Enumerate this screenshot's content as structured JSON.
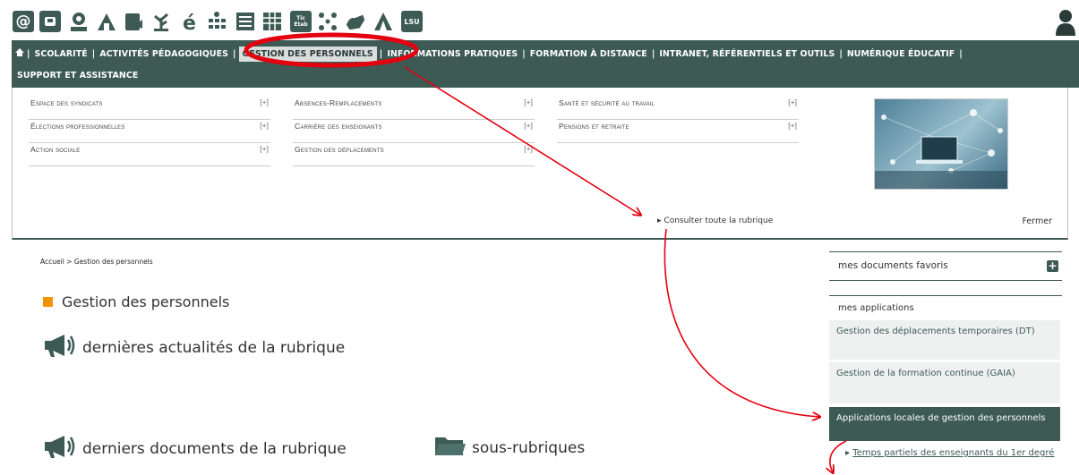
{
  "icon_bar": {
    "icons": [
      {
        "name": "at-icon",
        "glyph": "@"
      },
      {
        "name": "badge-icon",
        "glyph": ""
      },
      {
        "name": "person-icon",
        "glyph": ""
      },
      {
        "name": "reading-icon",
        "glyph": ""
      },
      {
        "name": "book-icon",
        "glyph": ""
      },
      {
        "name": "plant-icon",
        "glyph": ""
      },
      {
        "name": "e-learning-icon",
        "glyph": ""
      },
      {
        "name": "grid-icon",
        "glyph": ""
      },
      {
        "name": "list-icon",
        "glyph": ""
      },
      {
        "name": "table-icon",
        "glyph": ""
      },
      {
        "name": "tic-etab-icon",
        "glyph": "Tic Etab"
      },
      {
        "name": "network-icon",
        "glyph": ""
      },
      {
        "name": "hand-icon",
        "glyph": ""
      },
      {
        "name": "tent-icon",
        "glyph": ""
      },
      {
        "name": "lsu-icon",
        "glyph": "LSU"
      }
    ],
    "user_icon": "user-icon"
  },
  "nav": {
    "home_icon": "home-icon",
    "items": [
      {
        "label": "SCOLARITÉ"
      },
      {
        "label": "ACTIVITÉS PÉDAGOGIQUES"
      },
      {
        "label": "GESTION DES PERSONNELS",
        "active": true
      },
      {
        "label": "INFORMATIONS PRATIQUES"
      },
      {
        "label": "FORMATION À DISTANCE"
      },
      {
        "label": "INTRANET, RÉFÉRENTIELS ET OUTILS"
      },
      {
        "label": "NUMÉRIQUE ÉDUCATIF"
      },
      {
        "label": "SUPPORT ET ASSISTANCE"
      }
    ],
    "separator": "|"
  },
  "mega_menu": {
    "columns": [
      [
        {
          "label": "Espace des syndicats",
          "toggle": "[+]"
        },
        {
          "label": "Élections professionnelles",
          "toggle": "[+]"
        },
        {
          "label": "Action sociale",
          "toggle": "[+]"
        }
      ],
      [
        {
          "label": "Absences-Remplacements",
          "toggle": "[+]"
        },
        {
          "label": "Carrière des enseignants",
          "toggle": "[+]"
        },
        {
          "label": "Gestion des déplacements",
          "toggle": "[+]"
        }
      ],
      [
        {
          "label": "Santé et sécurité au travail",
          "toggle": "[+]"
        },
        {
          "label": "Pensions et retraite",
          "toggle": "[+]"
        }
      ]
    ],
    "consult_link": "Consulter toute la rubrique",
    "close_label": "Fermer"
  },
  "breadcrumb": {
    "home": "Accueil",
    "sep": ">",
    "current": "Gestion des personnels"
  },
  "page_title": "Gestion des personnels",
  "sections": {
    "news": "dernières actualités de la rubrique",
    "documents": "derniers documents de la rubrique",
    "subsections": "sous-rubriques"
  },
  "sidebar": {
    "favorites_title": "mes documents favoris",
    "favorites_add": "+",
    "apps_title": "mes applications",
    "apps": [
      {
        "label": "Gestion des déplacements temporaires (DT)"
      },
      {
        "label": "Gestion de la formation continue (GAIA)"
      },
      {
        "label": "Applications locales de gestion des personnels",
        "active": true
      }
    ],
    "sub_item": "Temps partiels des enseignants du 1er degré"
  },
  "colors": {
    "primary": "#3d5a55",
    "accent": "#f39200",
    "annotation": "#e3000f"
  }
}
